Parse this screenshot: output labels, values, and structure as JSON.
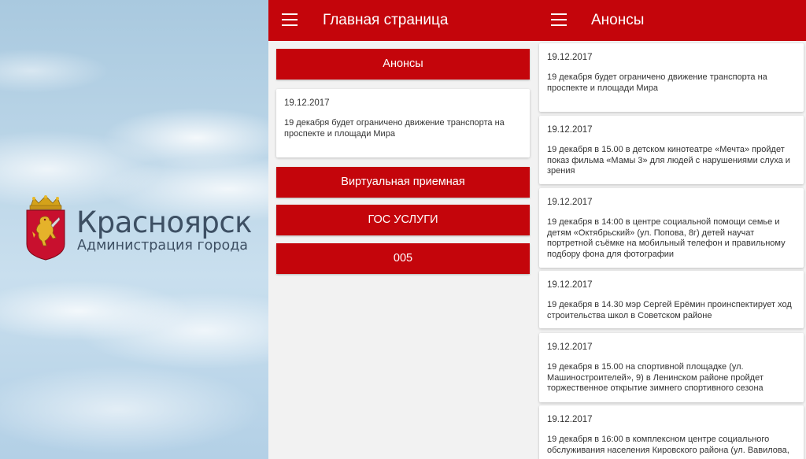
{
  "splash": {
    "city_name": "Красноярск",
    "subtitle": "Администрация города",
    "coat_of_arms_icon": "krasnoyarsk-coat-of-arms-lion"
  },
  "main_screen": {
    "title": "Главная страница",
    "menu_icon": "hamburger-menu-icon",
    "announcements_button": "Анонсы",
    "announcement_preview": {
      "date": "19.12.2017",
      "text": "19 декабря будет ограничено движение транспорта на проспекте и площади Мира"
    },
    "virtual_reception_button": "Виртуальная приемная",
    "gov_services_button": "ГОС УСЛУГИ",
    "button_005": "005"
  },
  "news_screen": {
    "title": "Анонсы",
    "menu_icon": "hamburger-menu-icon",
    "items": [
      {
        "date": "19.12.2017",
        "text": "19 декабря будет ограничено движение транспорта на проспекте и площади Мира"
      },
      {
        "date": "19.12.2017",
        "text": "19 декабря в 15.00 в детском кинотеатре «Мечта» пройдет показ фильма «Мамы 3» для людей с нарушениями слуха и зрения"
      },
      {
        "date": "19.12.2017",
        "text": "19 декабря в 14:00 в центре социальной помощи семье и детям «Октябрьский» (ул. Попова, 8г) детей научат портретной съёмке на мобильный телефон и правильному подбору фона для фотографии"
      },
      {
        "date": "19.12.2017",
        "text": "19 декабря в 14.30 мэр Сергей Ерёмин проинспектирует ход строительства школ в Советском районе"
      },
      {
        "date": "19.12.2017",
        "text": "19 декабря в 15.00 на спортивной площадке (ул. Машиностроителей», 9) в Ленинском районе пройдет торжественное открытие зимнего спортивного сезона"
      },
      {
        "date": "19.12.2017",
        "text": "19 декабря в 16:00 в комплексном центре социального обслуживания населения Кировского района (ул. Вавилова,"
      }
    ]
  },
  "colors": {
    "brand_red": "#c4050b",
    "background": "#f2f2f2",
    "card": "#ffffff",
    "logo_text": "#3d4f63"
  }
}
